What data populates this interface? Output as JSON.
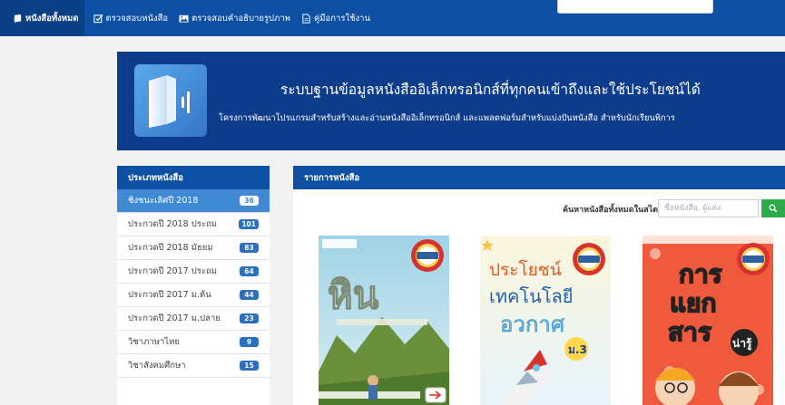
{
  "nav": {
    "items": [
      {
        "label": "หนังสือทั้งหมด",
        "icon": "book-icon",
        "active": true
      },
      {
        "label": "ตรวจสอบหนังสือ",
        "icon": "edit-check-icon",
        "active": false
      },
      {
        "label": "ตรวจสอบคำอธิบายรูปภาพ",
        "icon": "image-icon",
        "active": false
      },
      {
        "label": "คู่มือการใช้งาน",
        "icon": "document-icon",
        "active": false
      }
    ]
  },
  "hero": {
    "title": "ระบบฐานข้อมูลหนังสืออิเล็กทรอนิกส์ที่ทุกคนเข้าถึงและใช้ประโยชน์ได้",
    "subtitle": "โครงการพัฒนาโปรแกรมสำหรับสร้างและอ่านหนังสืออิเล็กทรอนิกส์ และแพลตฟอร์มสำหรับแบ่งปันหนังสือ สำหรับนักเรียนพิการ",
    "colors": {
      "background": "#0d3d8a",
      "logo_bg": "#3f8ad3"
    }
  },
  "sidebar": {
    "title": "ประเภทหนังสือ",
    "items": [
      {
        "label": "ชิงชนะเลิศปี 2018",
        "count": "36",
        "active": true
      },
      {
        "label": "ประกวดปี 2018 ประถม",
        "count": "101",
        "active": false
      },
      {
        "label": "ประกวดปี 2018 มัธยม",
        "count": "83",
        "active": false
      },
      {
        "label": "ประกวดปี 2017 ประถม",
        "count": "64",
        "active": false
      },
      {
        "label": "ประกวดปี 2017 ม.ต้น",
        "count": "44",
        "active": false
      },
      {
        "label": "ประกวดปี 2017 ม.ปลาย",
        "count": "23",
        "active": false
      },
      {
        "label": "วิชาภาษาไทย",
        "count": "9",
        "active": false
      },
      {
        "label": "วิชาสังคมศึกษา",
        "count": "15",
        "active": false
      }
    ]
  },
  "main": {
    "title": "รายการหนังสือ",
    "search": {
      "label": "ค้นหาหนังสือทั้งหมดในสไตร์",
      "placeholder": "ชื่อหนังสือ, ผู้แต่ง",
      "value": ""
    },
    "books": [
      {
        "title": "หิน",
        "badge": "รางวัล ชนะเลิศ"
      },
      {
        "title": "ประโยชน์ เทคโนโลยี อวกาศ",
        "badge": "รางวัล ชนะเลิศ",
        "grade": "ม.3"
      },
      {
        "title": "การ แยก สาร",
        "badge": "รางวัล ชนะเลิศ",
        "sticker": "น่ารู้"
      }
    ]
  },
  "colors": {
    "primary": "#0d4fa3",
    "accent": "#3f8ad3",
    "search_button": "#2eaa4c",
    "page_bg": "#f2f2f2"
  }
}
